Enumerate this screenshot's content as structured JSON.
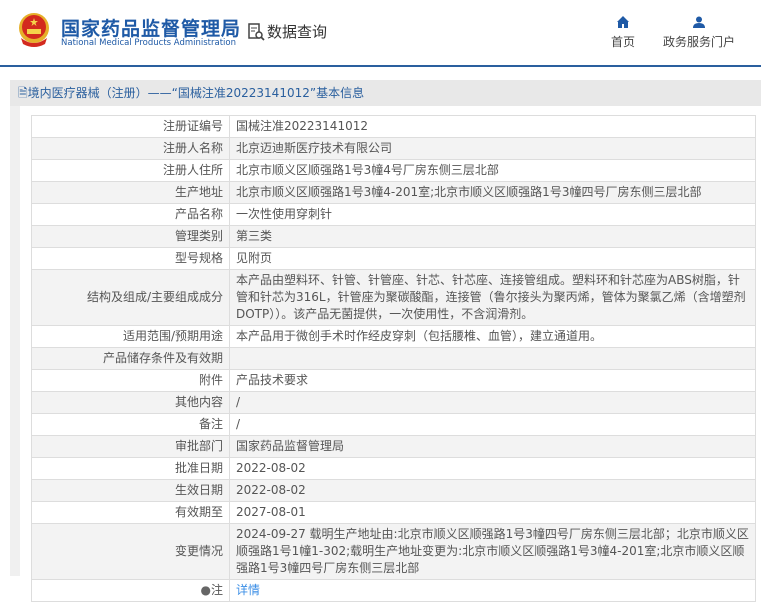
{
  "header": {
    "brand_cn": "国家药品监督管理局",
    "brand_en": "National Medical Products Administration",
    "data_query": "数据查询",
    "nav": [
      {
        "label": "首页",
        "icon": "home-icon"
      },
      {
        "label": "政务服务门户",
        "icon": "user-icon"
      }
    ]
  },
  "breadcrumb": "境内医疗器械（注册）——“国械注准20223141012”基本信息",
  "rows": [
    {
      "label": "注册证编号",
      "value": "国械注准20223141012"
    },
    {
      "label": "注册人名称",
      "value": "北京迈迪斯医疗技术有限公司"
    },
    {
      "label": "注册人住所",
      "value": "北京市顺义区顺强路1号3幢4号厂房东侧三层北部"
    },
    {
      "label": "生产地址",
      "value": "北京市顺义区顺强路1号3幢4-201室;北京市顺义区顺强路1号3幢四号厂房东侧三层北部"
    },
    {
      "label": "产品名称",
      "value": "一次性使用穿刺针"
    },
    {
      "label": "管理类别",
      "value": "第三类"
    },
    {
      "label": "型号规格",
      "value": "见附页"
    },
    {
      "label": "结构及组成/主要组成成分",
      "value": "本产品由塑料环、针管、针管座、针芯、针芯座、连接管组成。塑料环和针芯座为ABS树脂，针管和针芯为316L，针管座为聚碳酸酯，连接管（鲁尔接头为聚丙烯，管体为聚氯乙烯（含增塑剂DOTP））。该产品无菌提供，一次使用性，不含润滑剂。"
    },
    {
      "label": "适用范围/预期用途",
      "value": "本产品用于微创手术时作经皮穿刺（包括腰椎、血管），建立通道用。"
    },
    {
      "label": "产品储存条件及有效期",
      "value": ""
    },
    {
      "label": "附件",
      "value": "产品技术要求"
    },
    {
      "label": "其他内容",
      "value": "/"
    },
    {
      "label": "备注",
      "value": "/"
    },
    {
      "label": "审批部门",
      "value": "国家药品监督管理局"
    },
    {
      "label": "批准日期",
      "value": "2022-08-02"
    },
    {
      "label": "生效日期",
      "value": "2022-08-02"
    },
    {
      "label": "有效期至",
      "value": "2027-08-01"
    },
    {
      "label": "变更情况",
      "value": "2024-09-27 载明生产地址由:北京市顺义区顺强路1号3幢四号厂房东侧三层北部；北京市顺义区顺强路1号1幢1-302;载明生产地址变更为:北京市顺义区顺强路1号3幢4-201室;北京市顺义区顺强路1号3幢四号厂房东侧三层北部"
    }
  ],
  "note": {
    "label": "注",
    "link": "详情"
  },
  "colors": {
    "brand": "#1f5aa6",
    "link": "#3a8ee6"
  }
}
